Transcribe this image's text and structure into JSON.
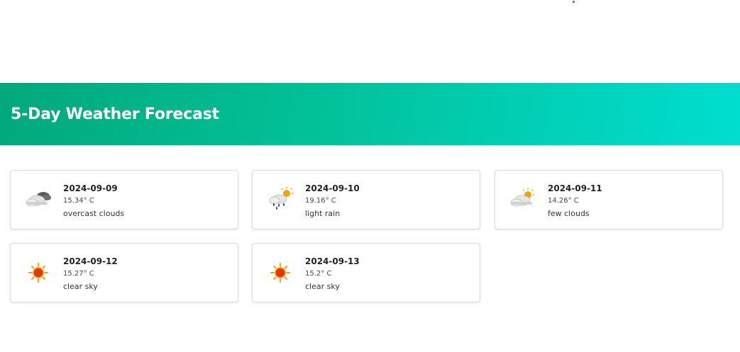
{
  "header": {
    "title": "5-Day Weather Forecast"
  },
  "forecast": [
    {
      "date": "2024-09-09",
      "temp": "15.34° C",
      "description": "overcast clouds",
      "icon": "overcast-clouds-icon"
    },
    {
      "date": "2024-09-10",
      "temp": "19.16° C",
      "description": "light rain",
      "icon": "light-rain-icon"
    },
    {
      "date": "2024-09-11",
      "temp": "14.26° C",
      "description": "few clouds",
      "icon": "few-clouds-icon"
    },
    {
      "date": "2024-09-12",
      "temp": "15.27° C",
      "description": "clear sky",
      "icon": "clear-sky-icon"
    },
    {
      "date": "2024-09-13",
      "temp": "15.2° C",
      "description": "clear sky",
      "icon": "clear-sky-icon"
    }
  ],
  "colors": {
    "banner_start": "#03a87b",
    "banner_end": "#00ded0",
    "sun": "#f5a20a",
    "rain": "#1a3fa8"
  }
}
